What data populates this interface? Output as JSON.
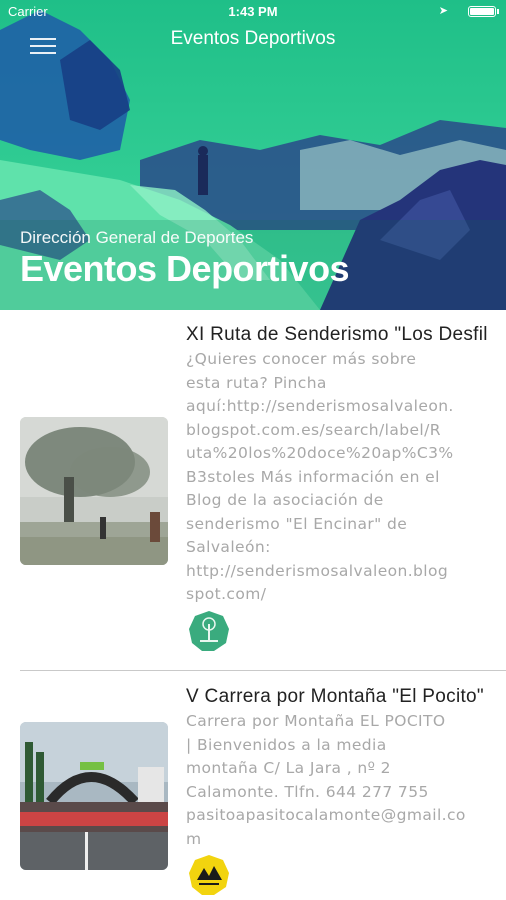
{
  "status_bar": {
    "carrier": "Carrier",
    "time": "1:43 PM"
  },
  "nav": {
    "title": "Eventos Deportivos",
    "menu_icon": "hamburger-menu-icon"
  },
  "hero": {
    "subtitle": "Dirección General de Deportes",
    "title": "Eventos Deportivos",
    "tint_color": "#2bd196"
  },
  "events": [
    {
      "title": "XI Ruta de Senderismo \"Los Desfiladeros\"",
      "description_lines": [
        "¿Quieres conocer más sobre",
        "esta ruta? Pincha",
        "aquí:http://senderismosalvaleon.",
        "blogspot.com.es/search/label/R",
        "uta%20los%20doce%20ap%C3%",
        "B3stoles Más información en el",
        "Blog de la asociación de",
        "senderismo \"El Encinar\" de",
        "Salvaleón:",
        "http://senderismosalvaleon.blog",
        "spot.com/"
      ],
      "badge_icon": "tree-badge-icon",
      "badge_color": "#3aab7e"
    },
    {
      "title": "V Carrera por Montaña \"El Pocito\"",
      "description_lines": [
        "Carrera por Montaña EL POCITO",
        "| Bienvenidos a la media",
        "montaña C/ La Jara , nº 2",
        "Calamonte. Tlfn. 644 277 755",
        "pasitoapasitocalamonte@gmail.co",
        "m"
      ],
      "badge_icon": "mountain-badge-icon",
      "badge_color": "#f2d40f"
    }
  ]
}
